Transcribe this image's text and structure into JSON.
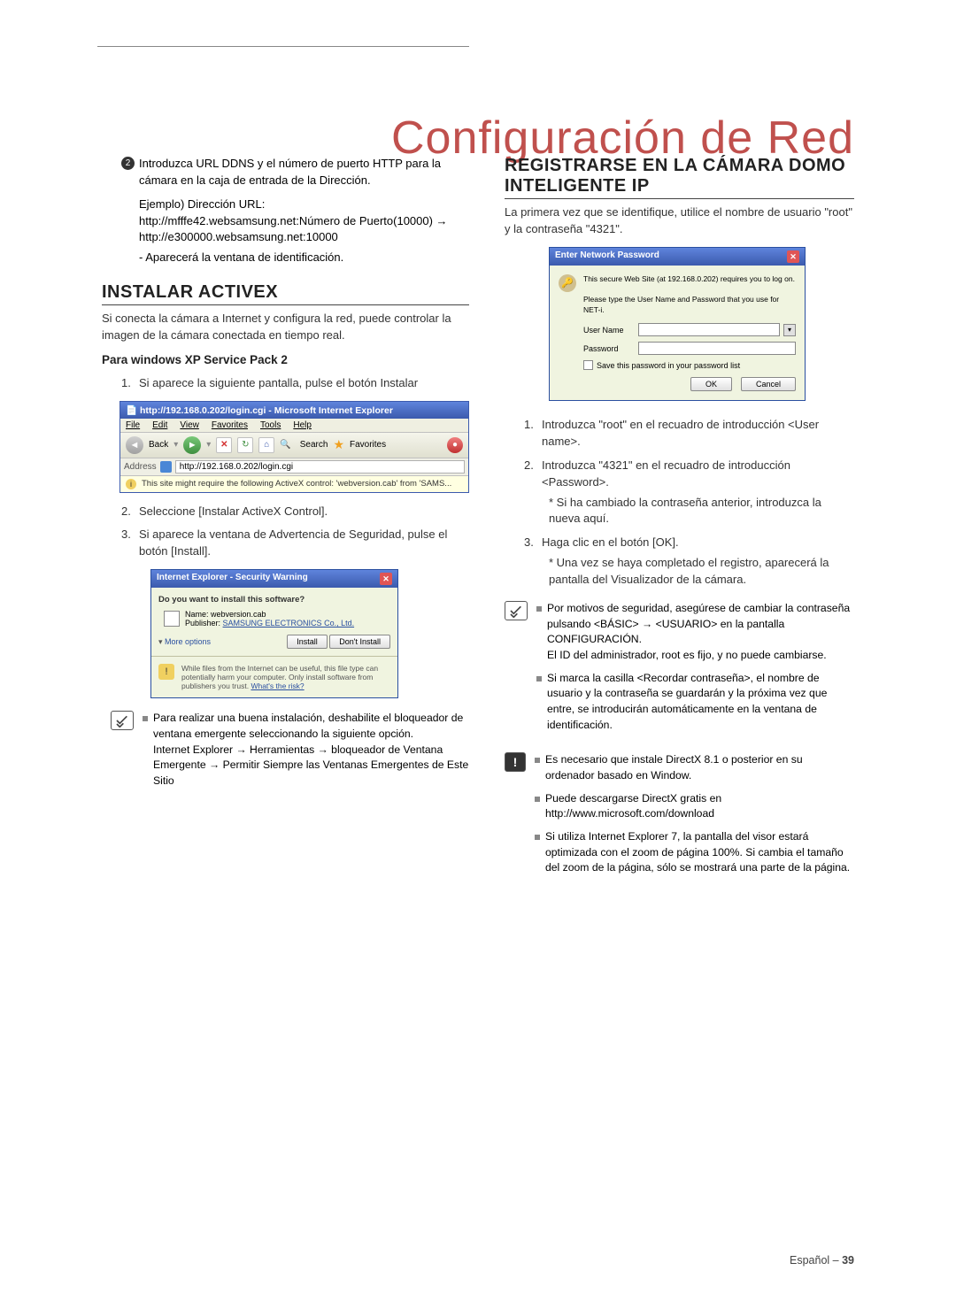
{
  "title": "Configuración de Red",
  "left": {
    "step2": {
      "num": "2",
      "l1": "Introduzca URL DDNS y el número de puerto HTTP para la cámara en la caja de entrada de la Dirección.",
      "l2": "Ejemplo) Dirección URL: http://mfffe42.websamsung.net:Número de Puerto(10000) → http://e300000.websamsung.net:10000",
      "l3": "- Aparecerá la ventana de identificación."
    },
    "h_activex": "INSTALAR ACTIVEX",
    "activex_intro": "Si conecta la cámara a Internet y configura la red, puede controlar la imagen de la cámara conectada en tiempo real.",
    "sp_heading": "Para windows XP Service Pack 2",
    "s1": {
      "num": "1.",
      "text": "Si aparece la siguiente pantalla, pulse el botón Instalar"
    },
    "browser": {
      "title": "http://192.168.0.202/login.cgi - Microsoft Internet Explorer",
      "file": "File",
      "edit": "Edit",
      "view": "View",
      "favorites": "Favorites",
      "tools": "Tools",
      "help": "Help",
      "back": "Back",
      "search": "Search",
      "fav_btn": "Favorites",
      "addr_label": "Address",
      "addr_url": "http://192.168.0.202/login.cgi",
      "infobar": "This site might require the following ActiveX control: 'webversion.cab' from 'SAMS..."
    },
    "s2": {
      "num": "2.",
      "text": "Seleccione [Instalar ActiveX Control]."
    },
    "s3": {
      "num": "3.",
      "text": "Si aparece la ventana de Advertencia de Seguridad, pulse el botón [Install]."
    },
    "secdialog": {
      "title": "Internet Explorer - Security Warning",
      "q": "Do you want to install this software?",
      "name_lbl": "Name:",
      "name": "webversion.cab",
      "pub_lbl": "Publisher:",
      "pub": "SAMSUNG ELECTRONICS Co., Ltd.",
      "more": "More options",
      "install": "Install",
      "dont": "Don't Install",
      "warn": "While files from the Internet can be useful, this file type can potentially harm your computer. Only install software from publishers you trust.",
      "risk": "What's the risk?"
    },
    "note1": {
      "b1": "Para realizar una buena instalación, deshabilite el bloqueador de ventana emergente seleccionando la siguiente opción.",
      "b1b": "Internet Explorer → Herramientas → bloqueador de Ventana Emergente → Permitir Siempre las Ventanas Emergentes de Este Sitio"
    }
  },
  "right": {
    "h_reg": "REGISTRARSE EN LA CÁMARA DOMO INTELIGENTE IP",
    "reg_intro": "La primera vez que se identifique, utilice el nombre de usuario \"root\" y la contraseña \"4321\".",
    "npdialog": {
      "title": "Enter Network Password",
      "desc1": "This secure Web Site (at 192.168.0.202) requires you to log on.",
      "desc2": "Please type the User Name and Password that you use for NET-i.",
      "user": "User Name",
      "pass": "Password",
      "save": "Save this password in your password list",
      "ok": "OK",
      "cancel": "Cancel"
    },
    "s1": {
      "num": "1.",
      "text": "Introduzca \"root\" en el recuadro de introducción <User name>."
    },
    "s2": {
      "num": "2.",
      "text": "Introduzca \"4321\" en el recuadro de introducción <Password>.",
      "sub": "* Si ha cambiado la contraseña anterior, introduzca la nueva aquí."
    },
    "s3": {
      "num": "3.",
      "text": "Haga clic en el botón [OK].",
      "sub": "* Una vez se haya completado el registro, aparecerá la pantalla del Visualizador de la cámara."
    },
    "note1": {
      "b1": "Por motivos de seguridad, asegúrese de cambiar la contraseña pulsando <BÁSIC> → <USUARIO> en la pantalla CONFIGURACIÓN.",
      "b1b": "El ID del administrador, root es fijo, y no puede cambiarse.",
      "b2": "Si marca la casilla <Recordar contraseña>, el nombre de usuario y la contraseña se guardarán y la próxima vez que entre, se introducirán automáticamente en la ventana de identificación."
    },
    "note2": {
      "b1": "Es necesario que instale DirectX 8.1 o posterior en su ordenador basado en Window.",
      "b2": "Puede descargarse DirectX gratis en http://www.microsoft.com/download",
      "b3": "Si utiliza Internet Explorer 7, la pantalla del visor estará optimizada con el zoom de página 100%. Si cambia el tamaño del zoom de la página, sólo se mostrará una parte de la página."
    }
  },
  "footer": {
    "lang": "Español – ",
    "page": "39"
  }
}
